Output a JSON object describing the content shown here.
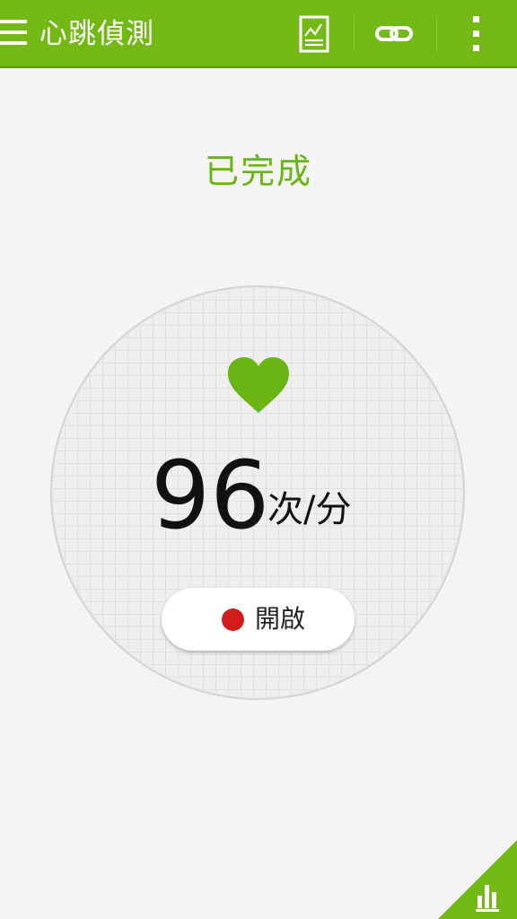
{
  "header": {
    "title": "心跳偵測",
    "icons": [
      "menu-icon",
      "chart-report-icon",
      "link-icon",
      "more-vertical-icon"
    ]
  },
  "status": {
    "text": "已完成"
  },
  "measurement": {
    "value": "96",
    "unit": "次/分",
    "icon": "heart-icon"
  },
  "start_button": {
    "label": "開啟",
    "icon": "record-dot-icon"
  },
  "corner": {
    "icon": "bar-chart-icon"
  },
  "colors": {
    "primary": "#72b916",
    "status_text": "#6ab414",
    "heart": "#6ab414",
    "record_dot": "#d21b1b",
    "background": "#f4f4f4"
  }
}
